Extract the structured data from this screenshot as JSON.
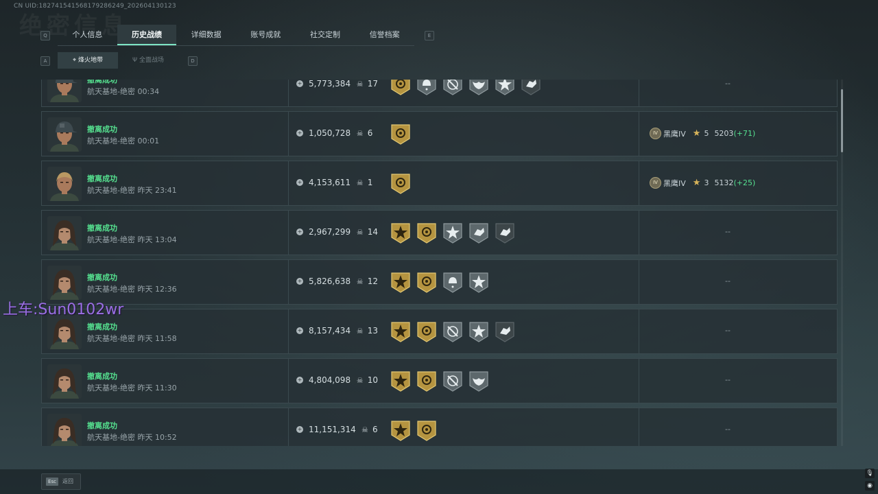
{
  "header": {
    "uid": "CN UID:1827415415681792862​49_202604130123",
    "bg_title": "绝密信息"
  },
  "nav": {
    "left_key": "Q",
    "right_key": "E",
    "tabs": [
      {
        "label": "个人信息",
        "active": false
      },
      {
        "label": "历史战绩",
        "active": true
      },
      {
        "label": "详细数据",
        "active": false
      },
      {
        "label": "账号成就",
        "active": false
      },
      {
        "label": "社交定制",
        "active": false
      },
      {
        "label": "信誉档案",
        "active": false
      }
    ]
  },
  "subnav": {
    "left_key": "A",
    "right_key": "D",
    "tabs": [
      {
        "label": "烽火地带",
        "icon": "crosshair-icon",
        "active": true
      },
      {
        "label": "全面战场",
        "icon": "antenna-icon",
        "active": false
      }
    ]
  },
  "matches": [
    {
      "status": "撤离成功",
      "map_time": "航天基地-绝密 00:34",
      "money": "5,773,384",
      "kills": "17",
      "avatar": "male-cap",
      "badges": [
        "gold-circle",
        "gray-helmet",
        "gray-gun",
        "gray-wings",
        "gray-star",
        "dark-hand"
      ],
      "rank": null,
      "dash": "--"
    },
    {
      "status": "撤离成功",
      "map_time": "航天基地-绝密 00:01",
      "money": "1,050,728",
      "kills": "6",
      "avatar": "male-cap",
      "badges": [
        "gold-circle"
      ],
      "rank": {
        "tier": "IV",
        "name": "黑鹰IV",
        "stars": "5",
        "score": "5203",
        "delta": "(+71)"
      },
      "dash": ""
    },
    {
      "status": "撤离成功",
      "map_time": "航天基地-绝密 昨天 23:41",
      "money": "4,153,611",
      "kills": "1",
      "avatar": "male-headset",
      "badges": [
        "gold-circle"
      ],
      "rank": {
        "tier": "IV",
        "name": "黑鹰IV",
        "stars": "3",
        "score": "5132",
        "delta": "(+25)"
      },
      "dash": ""
    },
    {
      "status": "撤离成功",
      "map_time": "航天基地-绝密 昨天 13:04",
      "money": "2,967,299",
      "kills": "14",
      "avatar": "female",
      "badges": [
        "gold-star",
        "gold-circle",
        "gray-star",
        "gray-hand",
        "dark-hand"
      ],
      "rank": null,
      "dash": "--"
    },
    {
      "status": "撤离成功",
      "map_time": "航天基地-绝密 昨天 12:36",
      "money": "5,826,638",
      "kills": "12",
      "avatar": "female",
      "badges": [
        "gold-star",
        "gold-circle",
        "gray-helmet",
        "gray-star"
      ],
      "rank": null,
      "dash": "--"
    },
    {
      "status": "撤离成功",
      "map_time": "航天基地-绝密 昨天 11:58",
      "money": "8,157,434",
      "kills": "13",
      "avatar": "female",
      "badges": [
        "gold-star",
        "gold-circle",
        "gray-gun",
        "gray-star",
        "dark-hand"
      ],
      "rank": null,
      "dash": "--"
    },
    {
      "status": "撤离成功",
      "map_time": "航天基地-绝密 昨天 11:30",
      "money": "4,804,098",
      "kills": "10",
      "avatar": "female",
      "badges": [
        "gold-star",
        "gold-circle",
        "gray-gun",
        "gray-wings"
      ],
      "rank": null,
      "dash": "--"
    },
    {
      "status": "撤离成功",
      "map_time": "航天基地-绝密 昨天 10:52",
      "money": "11,151,314",
      "kills": "6",
      "avatar": "female",
      "badges": [
        "gold-star",
        "gold-circle"
      ],
      "rank": null,
      "dash": "--"
    }
  ],
  "overlay_text": "上车:Sun0102wr",
  "footer": {
    "esc_key": "Esc",
    "esc_label": "返回"
  },
  "colors": {
    "accent": "#7ee5c4",
    "success": "#55e08f",
    "gold": "#c9a94f",
    "overlay": "#9a6fe3"
  }
}
